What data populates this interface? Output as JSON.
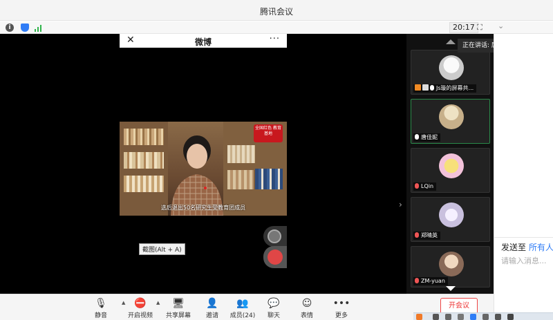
{
  "window": {
    "title": "腾讯会议"
  },
  "status": {
    "time": "20:17"
  },
  "stage": {
    "weibo_title": "微博",
    "subtitle": "选后退出50名研究生受教育团成员",
    "logo_text": "全国红色 教育基地",
    "tooltip": "截图(Alt + A)"
  },
  "speaking": {
    "label": "正在讲话: 唐佳妮"
  },
  "participants": [
    {
      "name": "Js璇的屏幕共...",
      "avatar_color": "#f2f2f2"
    },
    {
      "name": "唐佳妮",
      "avatar_color": "#d9c9a6"
    },
    {
      "name": "LQin",
      "avatar_color": "#f4d8e6"
    },
    {
      "name": "郑晴英",
      "avatar_color": "#e8e4f0"
    },
    {
      "name": "ZM-yuan",
      "avatar_color": "#c8a890"
    }
  ],
  "chat": {
    "send_to_label": "发送至",
    "send_to_target": "所有人",
    "input_placeholder": "请输入消息..."
  },
  "toolbar": {
    "mute": "静音",
    "video": "开启视频",
    "share": "共享屏幕",
    "invite": "邀请",
    "members": "成员(24)",
    "chat": "聊天",
    "reaction": "表情",
    "more": "更多",
    "leave": "开会议"
  },
  "colors": {
    "accent": "#2f7cf6",
    "leave": "#e33333",
    "stage_bg": "#000000"
  }
}
